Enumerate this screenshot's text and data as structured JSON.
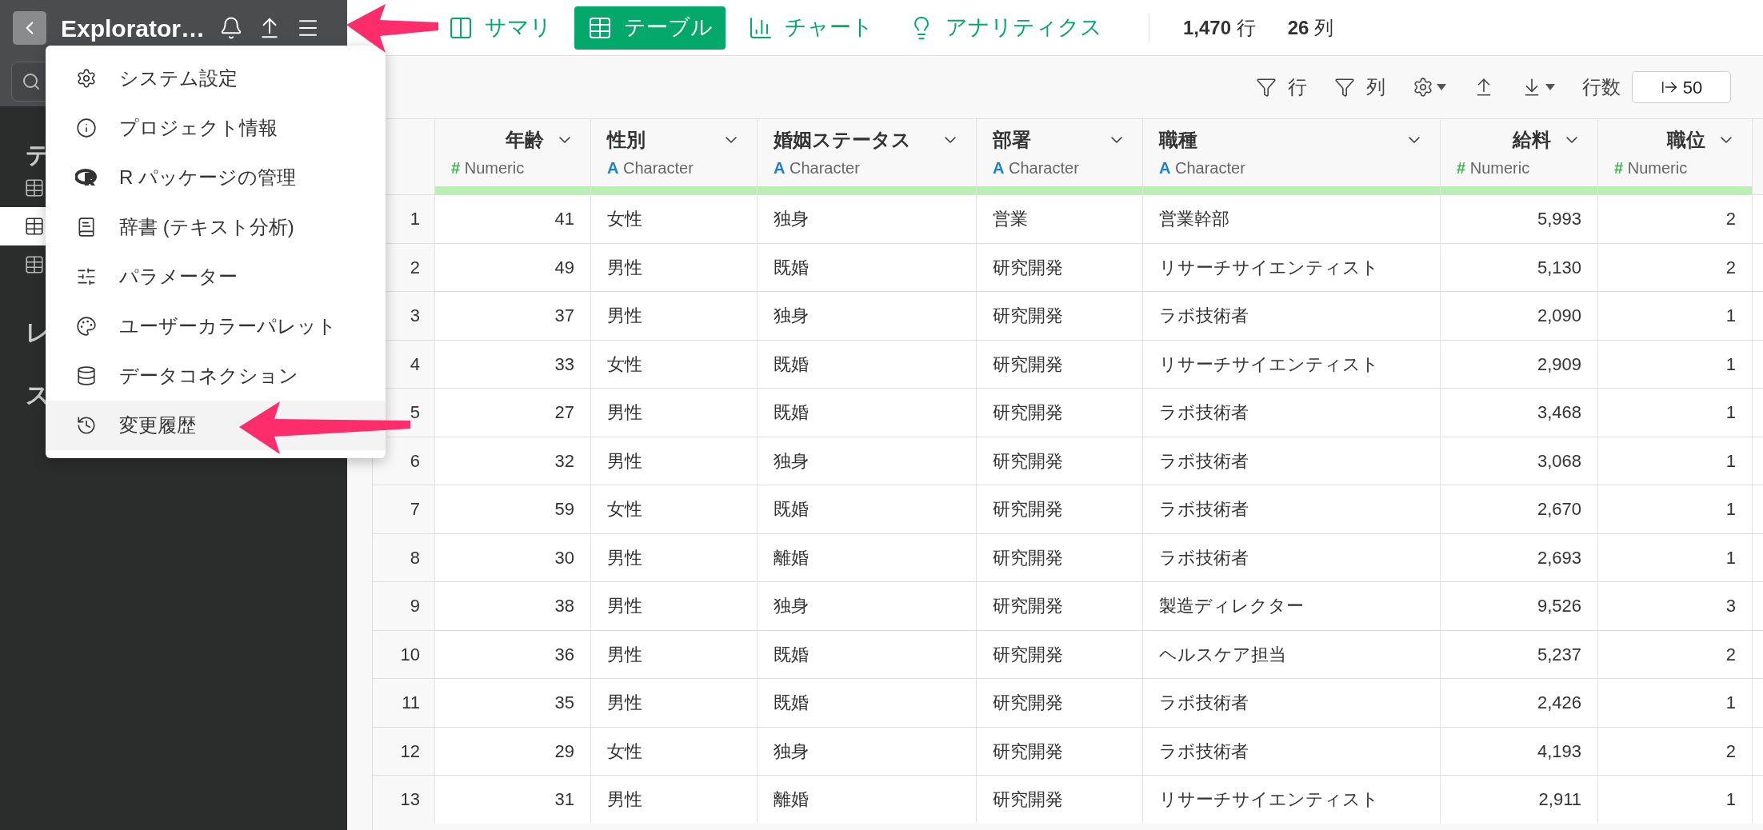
{
  "sidebar": {
    "title": "Explorator…",
    "sections": [
      {
        "label": "テ",
        "items": [
          {
            "selected": false
          },
          {
            "selected": true
          },
          {
            "selected": false
          }
        ]
      },
      {
        "label": "レ"
      },
      {
        "label": "ス"
      }
    ]
  },
  "menu": {
    "items": [
      {
        "label": "システム設定",
        "selected": false
      },
      {
        "label": "プロジェクト情報",
        "selected": false
      },
      {
        "label": "R パッケージの管理",
        "selected": false
      },
      {
        "label": "辞書 (テキスト分析)",
        "selected": false
      },
      {
        "label": "パラメーター",
        "selected": false
      },
      {
        "label": "ユーザーカラーパレット",
        "selected": false
      },
      {
        "label": "データコネクション",
        "selected": false
      },
      {
        "label": "変更履歴",
        "selected": true
      }
    ]
  },
  "tabs": [
    {
      "label": "サマリ",
      "selected": false
    },
    {
      "label": "テーブル",
      "selected": true
    },
    {
      "label": "チャート",
      "selected": false
    },
    {
      "label": "アナリティクス",
      "selected": false
    }
  ],
  "counts": [
    {
      "value": "1,470",
      "unit": "行"
    },
    {
      "value": "26",
      "unit": "列"
    }
  ],
  "toolbar": {
    "row_filter": "行",
    "column_filter": "列",
    "rows_label": "行数",
    "rows_value": "50"
  },
  "table": {
    "columns": [
      {
        "name": "年齢",
        "kind": "numeric",
        "type_mark": "#",
        "type": "Numeric"
      },
      {
        "name": "性別",
        "kind": "character",
        "type_mark": "A",
        "type": "Character"
      },
      {
        "name": "婚姻ステータス",
        "kind": "character",
        "type_mark": "A",
        "type": "Character"
      },
      {
        "name": "部署",
        "kind": "character",
        "type_mark": "A",
        "type": "Character"
      },
      {
        "name": "職種",
        "kind": "character",
        "type_mark": "A",
        "type": "Character"
      },
      {
        "name": "給料",
        "kind": "numeric",
        "type_mark": "#",
        "type": "Numeric"
      },
      {
        "name": "職位",
        "kind": "numeric",
        "type_mark": "#",
        "type": "Numeric"
      }
    ],
    "rows": [
      {
        "number": "1",
        "cells": [
          "41",
          "女性",
          "独身",
          "営業",
          "営業幹部",
          "5,993",
          "2"
        ]
      },
      {
        "number": "2",
        "cells": [
          "49",
          "男性",
          "既婚",
          "研究開発",
          "リサーチサイエンティスト",
          "5,130",
          "2"
        ]
      },
      {
        "number": "3",
        "cells": [
          "37",
          "男性",
          "独身",
          "研究開発",
          "ラボ技術者",
          "2,090",
          "1"
        ]
      },
      {
        "number": "4",
        "cells": [
          "33",
          "女性",
          "既婚",
          "研究開発",
          "リサーチサイエンティスト",
          "2,909",
          "1"
        ]
      },
      {
        "number": "5",
        "cells": [
          "27",
          "男性",
          "既婚",
          "研究開発",
          "ラボ技術者",
          "3,468",
          "1"
        ]
      },
      {
        "number": "6",
        "cells": [
          "32",
          "男性",
          "独身",
          "研究開発",
          "ラボ技術者",
          "3,068",
          "1"
        ]
      },
      {
        "number": "7",
        "cells": [
          "59",
          "女性",
          "既婚",
          "研究開発",
          "ラボ技術者",
          "2,670",
          "1"
        ]
      },
      {
        "number": "8",
        "cells": [
          "30",
          "男性",
          "離婚",
          "研究開発",
          "ラボ技術者",
          "2,693",
          "1"
        ]
      },
      {
        "number": "9",
        "cells": [
          "38",
          "男性",
          "独身",
          "研究開発",
          "製造ディレクター",
          "9,526",
          "3"
        ]
      },
      {
        "number": "10",
        "cells": [
          "36",
          "男性",
          "既婚",
          "研究開発",
          "ヘルスケア担当",
          "5,237",
          "2"
        ]
      },
      {
        "number": "11",
        "cells": [
          "35",
          "男性",
          "既婚",
          "研究開発",
          "ラボ技術者",
          "2,426",
          "1"
        ]
      },
      {
        "number": "12",
        "cells": [
          "29",
          "女性",
          "独身",
          "研究開発",
          "ラボ技術者",
          "4,193",
          "2"
        ]
      },
      {
        "number": "13",
        "cells": [
          "31",
          "男性",
          "離婚",
          "研究開発",
          "リサーチサイエンティスト",
          "2,911",
          "1"
        ]
      }
    ]
  }
}
